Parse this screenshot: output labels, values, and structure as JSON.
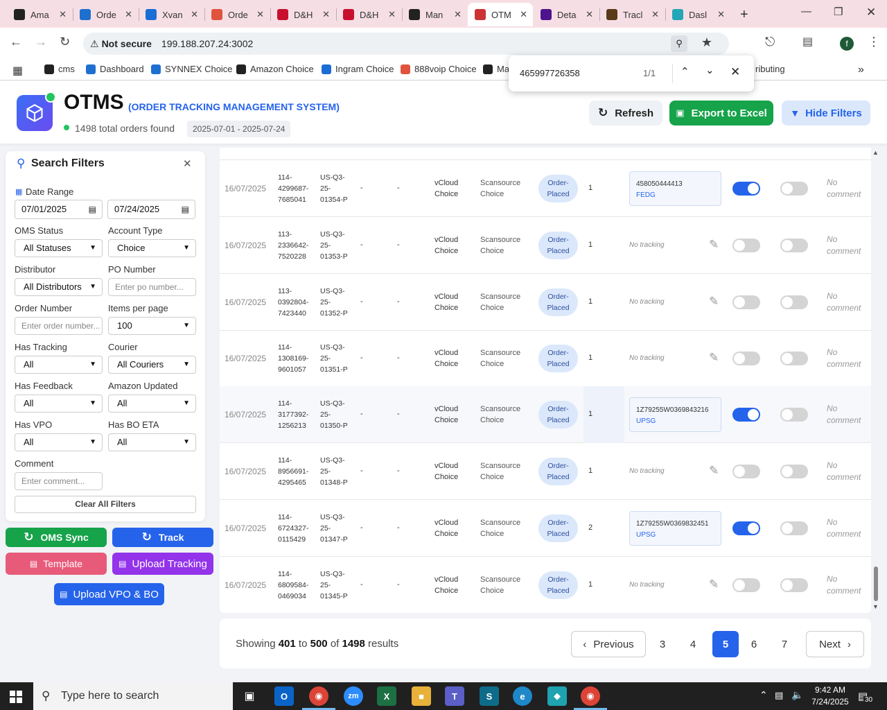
{
  "browser": {
    "tabs": [
      {
        "label": "Ama",
        "icon": "amazon-icon",
        "color": "#222"
      },
      {
        "label": "Orde",
        "icon": "ec-icon",
        "color": "#1e6fd0"
      },
      {
        "label": "Xvan",
        "icon": "xvantage-icon",
        "color": "#1a6dd4"
      },
      {
        "label": "Orde",
        "icon": "ordertrack-icon",
        "color": "#e0533d"
      },
      {
        "label": "D&H",
        "icon": "dh-icon",
        "color": "#c8102e"
      },
      {
        "label": "D&H",
        "icon": "dh-icon",
        "color": "#c8102e"
      },
      {
        "label": "Man",
        "icon": "amazon-icon",
        "color": "#222"
      },
      {
        "label": "OTM",
        "icon": "otms-icon",
        "color": "#c33"
      },
      {
        "label": "Deta",
        "icon": "fedex-icon",
        "color": "#4d148c"
      },
      {
        "label": "Tracl",
        "icon": "ups-icon",
        "color": "#5b3a1a"
      },
      {
        "label": "Dasl",
        "icon": "dashboard-icon",
        "color": "#23a6b8"
      }
    ],
    "url_security": "Not secure",
    "url": "199.188.207.24:3002",
    "bookmarks": [
      {
        "label": "cms",
        "color": "#222"
      },
      {
        "label": "Dashboard",
        "color": "#1e6fd0"
      },
      {
        "label": "SYNNEX Choice",
        "color": "#1e6fd0"
      },
      {
        "label": "Amazon Choice",
        "color": "#222"
      },
      {
        "label": "Ingram Choice",
        "color": "#1a6dd4"
      },
      {
        "label": "888voip Choice",
        "color": "#e0533d"
      },
      {
        "label": "Ma",
        "color": "#222"
      }
    ],
    "bookmark_overflow": "ributing",
    "find": {
      "query": "465997726358",
      "count": "1/1"
    }
  },
  "app": {
    "title": "OTMS",
    "subtitle": "(ORDER TRACKING MANAGEMENT SYSTEM)",
    "total_orders": "1498 total orders found",
    "date_range_chip": "2025-07-01 - 2025-07-24",
    "refresh_label": "Refresh",
    "export_label": "Export to Excel",
    "hide_filters_label": "Hide Filters",
    "accent": "#2563eb",
    "export_color": "#16a34a"
  },
  "filters": {
    "title": "Search Filters",
    "date_range_label": "Date Range",
    "date_from": "07/01/2025",
    "date_to": "07/24/2025",
    "oms_status_label": "OMS Status",
    "oms_status_value": "All Statuses",
    "account_type_label": "Account Type",
    "account_type_value": "Choice",
    "distributor_label": "Distributor",
    "distributor_value": "All Distributors",
    "po_number_label": "PO Number",
    "po_number_placeholder": "Enter po number...",
    "order_number_label": "Order Number",
    "order_number_placeholder": "Enter order number...",
    "items_per_page_label": "Items per page",
    "items_per_page_value": "100",
    "has_tracking_label": "Has Tracking",
    "has_tracking_value": "All",
    "courier_label": "Courier",
    "courier_value": "All Couriers",
    "has_feedback_label": "Has Feedback",
    "has_feedback_value": "All",
    "amazon_updated_label": "Amazon Updated",
    "amazon_updated_value": "All",
    "has_vpo_label": "Has VPO",
    "has_vpo_value": "All",
    "has_bo_eta_label": "Has BO ETA",
    "has_bo_eta_value": "All",
    "comment_label": "Comment",
    "comment_placeholder": "Enter comment...",
    "clear_label": "Clear All Filters"
  },
  "actions": {
    "oms_sync": "OMS Sync",
    "track": "Track",
    "template": "Template",
    "upload_tracking": "Upload Tracking",
    "upload_vpo": "Upload VPO & BO"
  },
  "orders": [
    {
      "date": "16/07/2025",
      "order": [
        "114-",
        "4299687-",
        "7685041"
      ],
      "po": [
        "US-Q3-",
        "25-",
        "01354-P"
      ],
      "c1": "-",
      "c2": "-",
      "account": [
        "vCloud",
        "Choice"
      ],
      "distributor": [
        "Scansource",
        "Choice"
      ],
      "status": [
        "Order-",
        "Placed"
      ],
      "qty": "1",
      "tracking": "458050444413",
      "carrier": "FEDG",
      "toggle1": true,
      "toggle2": false,
      "comment": [
        "No",
        "comment"
      ]
    },
    {
      "date": "16/07/2025",
      "order": [
        "113-",
        "2336642-",
        "7520228"
      ],
      "po": [
        "US-Q3-",
        "25-",
        "01353-P"
      ],
      "c1": "-",
      "c2": "-",
      "account": [
        "vCloud",
        "Choice"
      ],
      "distributor": [
        "Scansource",
        "Choice"
      ],
      "status": [
        "Order-",
        "Placed"
      ],
      "qty": "1",
      "tracking": "",
      "carrier": "",
      "notracking": "No tracking",
      "toggle1": false,
      "toggle2": false,
      "comment": [
        "No",
        "comment"
      ]
    },
    {
      "date": "16/07/2025",
      "order": [
        "113-",
        "0392804-",
        "7423440"
      ],
      "po": [
        "US-Q3-",
        "25-",
        "01352-P"
      ],
      "c1": "-",
      "c2": "-",
      "account": [
        "vCloud",
        "Choice"
      ],
      "distributor": [
        "Scansource",
        "Choice"
      ],
      "status": [
        "Order-",
        "Placed"
      ],
      "qty": "1",
      "tracking": "",
      "carrier": "",
      "notracking": "No tracking",
      "toggle1": false,
      "toggle2": false,
      "comment": [
        "No",
        "comment"
      ]
    },
    {
      "date": "16/07/2025",
      "order": [
        "114-",
        "1308169-",
        "9601057"
      ],
      "po": [
        "US-Q3-",
        "25-",
        "01351-P"
      ],
      "c1": "-",
      "c2": "-",
      "account": [
        "vCloud",
        "Choice"
      ],
      "distributor": [
        "Scansource",
        "Choice"
      ],
      "status": [
        "Order-",
        "Placed"
      ],
      "qty": "1",
      "tracking": "",
      "carrier": "",
      "notracking": "No tracking",
      "toggle1": false,
      "toggle2": false,
      "comment": [
        "No",
        "comment"
      ]
    },
    {
      "date": "16/07/2025",
      "order": [
        "114-",
        "3177392-",
        "1256213"
      ],
      "po": [
        "US-Q3-",
        "25-",
        "01350-P"
      ],
      "c1": "-",
      "c2": "-",
      "account": [
        "vCloud",
        "Choice"
      ],
      "distributor": [
        "Scansource",
        "Choice"
      ],
      "status": [
        "Order-",
        "Placed"
      ],
      "qty": "1",
      "tracking": "1Z79255W0369843216",
      "carrier": "UPSG",
      "toggle1": true,
      "toggle2": false,
      "comment": [
        "No",
        "comment"
      ]
    },
    {
      "date": "16/07/2025",
      "order": [
        "114-",
        "8956691-",
        "4295465"
      ],
      "po": [
        "US-Q3-",
        "25-",
        "01348-P"
      ],
      "c1": "-",
      "c2": "-",
      "account": [
        "vCloud",
        "Choice"
      ],
      "distributor": [
        "Scansource",
        "Choice"
      ],
      "status": [
        "Order-",
        "Placed"
      ],
      "qty": "1",
      "tracking": "",
      "carrier": "",
      "notracking": "No tracking",
      "toggle1": false,
      "toggle2": false,
      "comment": [
        "No",
        "comment"
      ]
    },
    {
      "date": "16/07/2025",
      "order": [
        "114-",
        "6724327-",
        "0115429"
      ],
      "po": [
        "US-Q3-",
        "25-",
        "01347-P"
      ],
      "c1": "-",
      "c2": "-",
      "account": [
        "vCloud",
        "Choice"
      ],
      "distributor": [
        "Scansource",
        "Choice"
      ],
      "status": [
        "Order-",
        "Placed"
      ],
      "qty": "2",
      "tracking": "1Z79255W0369832451",
      "carrier": "UPSG",
      "toggle1": true,
      "toggle2": false,
      "comment": [
        "No",
        "comment"
      ]
    },
    {
      "date": "16/07/2025",
      "order": [
        "114-",
        "6809584-",
        "0469034"
      ],
      "po": [
        "US-Q3-",
        "25-",
        "01345-P"
      ],
      "c1": "-",
      "c2": "-",
      "account": [
        "vCloud",
        "Choice"
      ],
      "distributor": [
        "Scansource",
        "Choice"
      ],
      "status": [
        "Order-",
        "Placed"
      ],
      "qty": "1",
      "tracking": "",
      "carrier": "",
      "notracking": "No tracking",
      "toggle1": false,
      "toggle2": false,
      "comment": [
        "No",
        "comment"
      ]
    }
  ],
  "pagination": {
    "showing_prefix": "Showing",
    "from": "401",
    "to_word": "to",
    "to": "500",
    "of_word": "of",
    "total": "1498",
    "suffix": "results",
    "previous": "Previous",
    "pages": [
      "3",
      "4",
      "5",
      "6",
      "7"
    ],
    "current": "5",
    "next": "Next"
  },
  "taskbar": {
    "search_placeholder": "Type here to search",
    "time": "9:42 AM",
    "date": "7/24/2025",
    "notifications": "30"
  }
}
